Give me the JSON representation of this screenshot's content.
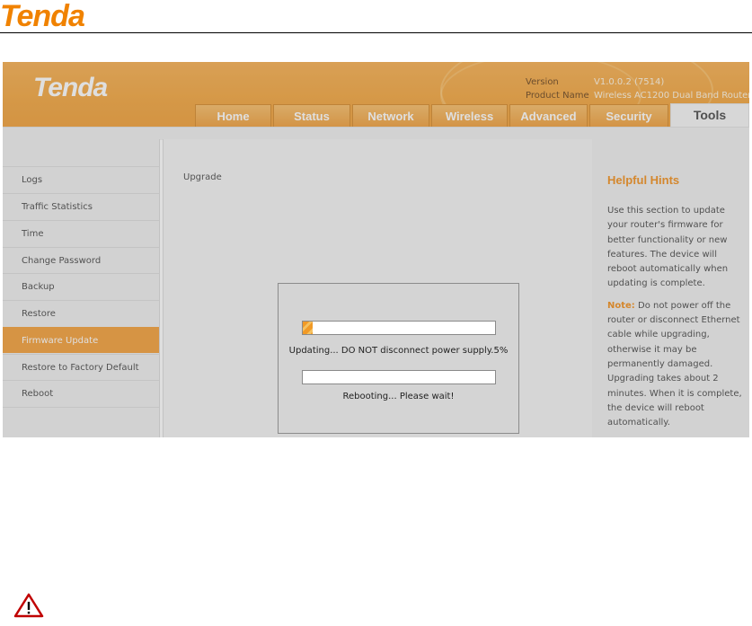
{
  "doc": {
    "logo": "Tenda"
  },
  "header": {
    "logo": "Tenda",
    "version_label": "Version",
    "version_value": "V1.0.0.2 (7514)",
    "product_label": "Product Name",
    "product_value": "Wireless AC1200 Dual Band Router"
  },
  "tabs": [
    "Home",
    "Status",
    "Network",
    "Wireless",
    "Advanced",
    "Security",
    "Tools"
  ],
  "active_tab": "Tools",
  "sidebar": {
    "items": [
      "Logs",
      "Traffic Statistics",
      "Time",
      "Change Password",
      "Backup",
      "Restore",
      "Firmware Update",
      "Restore to Factory Default",
      "Reboot"
    ],
    "active": "Firmware Update"
  },
  "main": {
    "title": "Upgrade"
  },
  "hints": {
    "title": "Helpful Hints",
    "body": "Use this section to update your router's firmware for better functionality or new features. The device will reboot automatically when updating is complete.",
    "note_label": "Note:",
    "note_text": "Do not power off the router or disconnect Ethernet cable while upgrading, otherwise it may be permanently damaged. Upgrading takes about 2 minutes. When it is complete, the device will reboot automatically."
  },
  "dialog": {
    "upgrade_status": "Updating... DO NOT disconnect power supply.5%",
    "upgrade_progress_percent": 5,
    "reboot_status": "Rebooting... Please wait!",
    "reboot_progress_percent": 0
  },
  "colors": {
    "brand_orange": "#f08200",
    "header_orange": "#f19a26",
    "sidebar_active": "#f39422"
  },
  "icons": {
    "warning": "warning-triangle-icon"
  }
}
